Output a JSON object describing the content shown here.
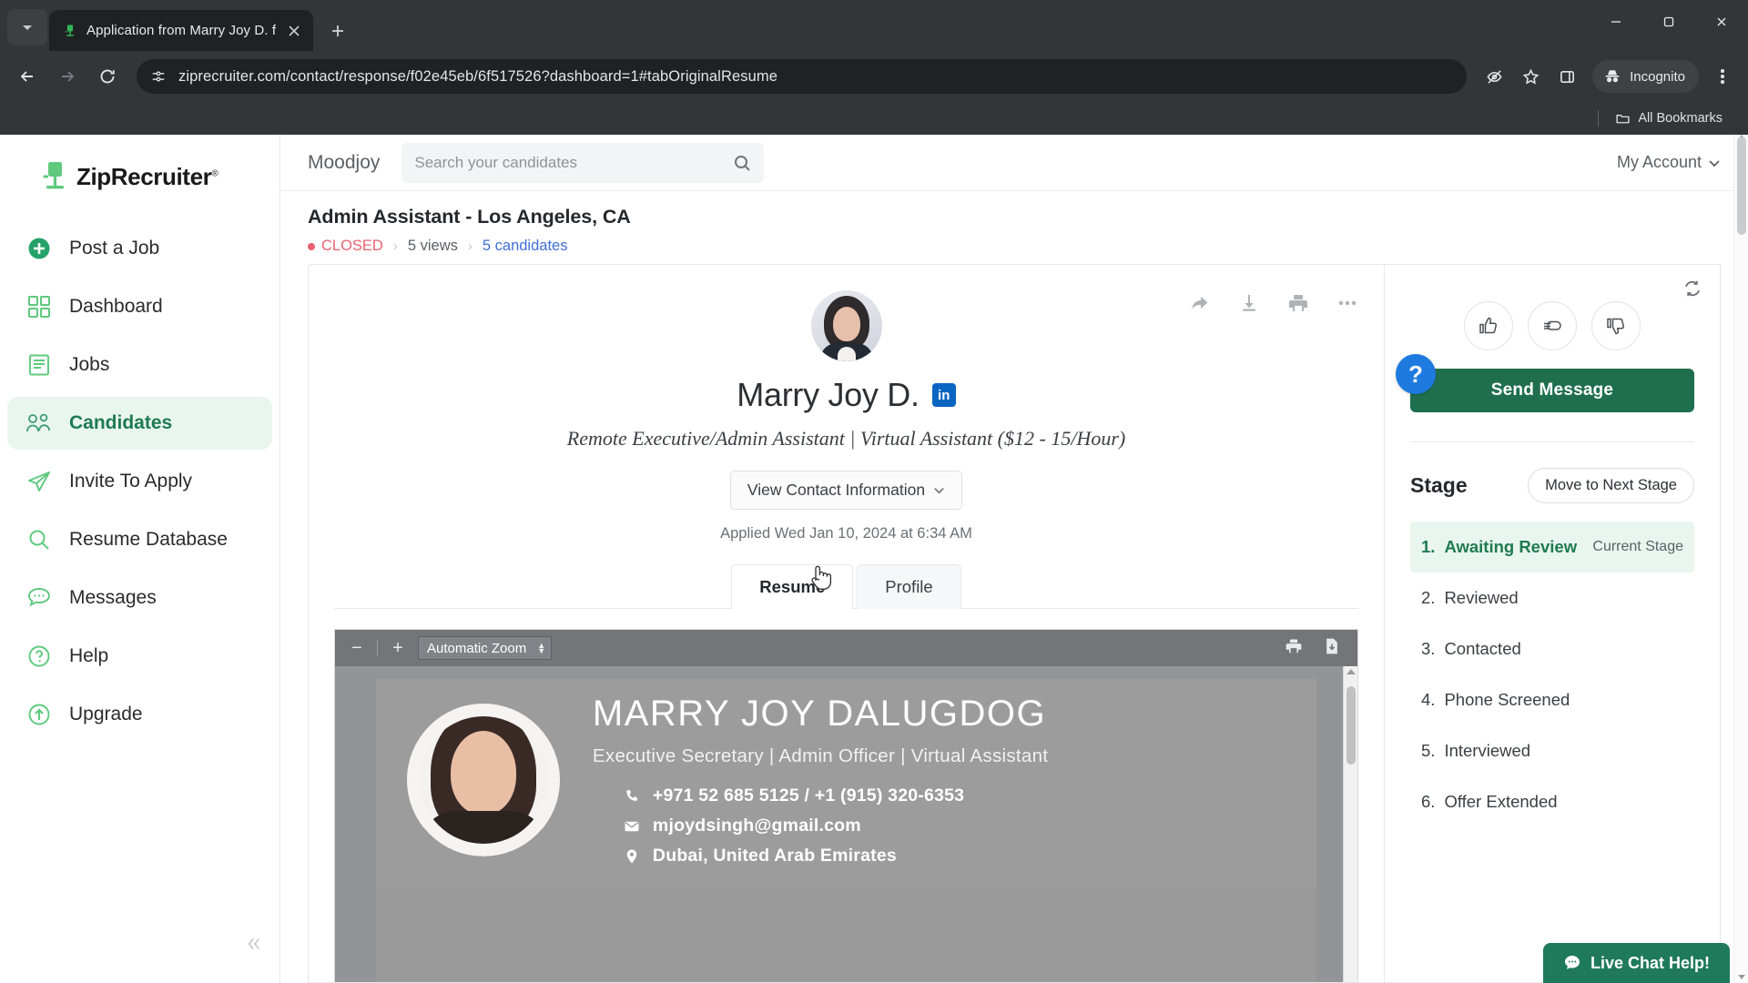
{
  "browser": {
    "tab": {
      "title": "Application from Marry Joy D. f",
      "favicon_icon": "green-chair-favicon",
      "close_icon": "close-icon"
    },
    "new_tab_icon": "plus-icon",
    "tab_search_icon": "chevron-down-icon",
    "window_controls": {
      "minimize": "minimize-icon",
      "maximize": "maximize-icon",
      "close": "close-icon"
    },
    "nav": {
      "back_icon": "back-arrow-icon",
      "forward_icon": "forward-arrow-icon",
      "reload_icon": "reload-icon"
    },
    "omnibox": {
      "site_info_icon": "site-settings-icon",
      "url": "ziprecruiter.com/contact/response/f02e45eb/6f517526?dashboard=1#tabOriginalResume"
    },
    "toolbar_icons": {
      "tracking": "eye-off-icon",
      "bookmark": "star-icon",
      "side_panel": "side-panel-icon",
      "menu": "kebab-menu-icon"
    },
    "incognito": {
      "label": "Incognito",
      "icon": "incognito-icon"
    },
    "bookmarks": {
      "all_bookmarks_label": "All Bookmarks",
      "folder_icon": "folder-icon"
    }
  },
  "sidebar": {
    "logo": {
      "text": "ZipRecruiter",
      "tm": "®",
      "icon": "green-chair-logo"
    },
    "items": [
      {
        "label": "Post a Job",
        "icon": "plus-circle-icon",
        "active": false
      },
      {
        "label": "Dashboard",
        "icon": "grid-icon",
        "active": false
      },
      {
        "label": "Jobs",
        "icon": "document-lines-icon",
        "active": false
      },
      {
        "label": "Candidates",
        "icon": "people-icon",
        "active": true
      },
      {
        "label": "Invite To Apply",
        "icon": "paper-plane-icon",
        "active": false
      },
      {
        "label": "Resume Database",
        "icon": "magnifier-icon",
        "active": false
      },
      {
        "label": "Messages",
        "icon": "chat-bubble-icon",
        "active": false
      },
      {
        "label": "Help",
        "icon": "question-circle-icon",
        "active": false
      },
      {
        "label": "Upgrade",
        "icon": "up-arrow-circle-icon",
        "active": false
      }
    ],
    "collapse_icon": "double-chevron-left-icon"
  },
  "topbar": {
    "org_name": "Moodjoy",
    "search_placeholder": "Search your candidates",
    "search_icon": "search-icon",
    "my_account_label": "My Account",
    "my_account_caret": "chevron-down-icon"
  },
  "job": {
    "title": "Admin Assistant - Los Angeles, CA",
    "status": "CLOSED",
    "views": "5 views",
    "candidates": "5 candidates",
    "separator": "›"
  },
  "candidate": {
    "name": "Marry Joy D.",
    "linkedin_badge": "in",
    "tagline": "Remote Executive/Admin Assistant | Virtual Assistant ($12 - 15/Hour)",
    "contact_button": "View Contact Information",
    "applied": "Applied Wed Jan 10, 2024 at 6:34 AM",
    "avatar_icon": "candidate-avatar",
    "actions": [
      {
        "name": "share-icon"
      },
      {
        "name": "download-icon"
      },
      {
        "name": "print-icon"
      },
      {
        "name": "more-options-icon"
      }
    ],
    "tabs": [
      {
        "label": "Resume",
        "active": true
      },
      {
        "label": "Profile",
        "active": false
      }
    ]
  },
  "pdf_viewer": {
    "zoom_out_label": "−",
    "zoom_in_label": "+",
    "zoom_value": "Automatic Zoom",
    "print_icon": "print-icon",
    "save_icon": "save-document-icon",
    "resume": {
      "name": "MARRY JOY DALUGDOG",
      "subtitle": "Executive Secretary | Admin Officer | Virtual Assistant",
      "phone": "+971 52 685 5125 / +1 (915) 320-6353",
      "email": "mjoydsingh@gmail.com",
      "location": "Dubai, United Arab Emirates",
      "phone_icon": "phone-icon",
      "email_icon": "envelope-icon",
      "location_icon": "map-pin-icon",
      "photo_icon": "resume-photo"
    }
  },
  "right_panel": {
    "refresh_icon": "refresh-icon",
    "rating_buttons": [
      {
        "name": "thumbs-up-icon"
      },
      {
        "name": "pointing-hand-icon"
      },
      {
        "name": "thumbs-down-icon"
      }
    ],
    "help_badge": "?",
    "send_message_label": "Send Message",
    "stage_heading": "Stage",
    "move_next_label": "Move to Next Stage",
    "current_stage_tag": "Current Stage",
    "stages": [
      {
        "num": "1.",
        "label": "Awaiting Review",
        "current": true
      },
      {
        "num": "2.",
        "label": "Reviewed",
        "current": false
      },
      {
        "num": "3.",
        "label": "Contacted",
        "current": false
      },
      {
        "num": "4.",
        "label": "Phone Screened",
        "current": false
      },
      {
        "num": "5.",
        "label": "Interviewed",
        "current": false
      },
      {
        "num": "6.",
        "label": "Offer Extended",
        "current": false
      }
    ]
  },
  "live_chat": {
    "label": "Live Chat Help!",
    "icon": "chat-bubble-icon"
  },
  "colors": {
    "brand_green": "#1f7a52",
    "accent_green": "#1f6f4f",
    "closed_red": "#e8626f",
    "link_blue": "#3f6fd6",
    "linkedin_blue": "#0a66c2",
    "help_blue": "#1f7ae0"
  }
}
